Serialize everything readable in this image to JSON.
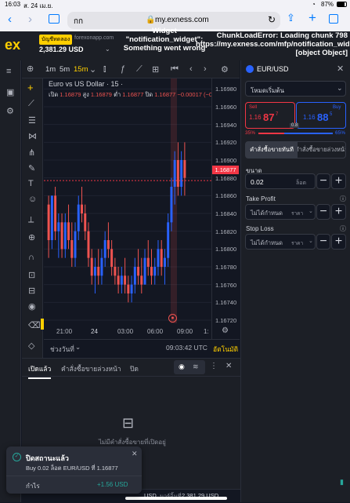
{
  "status": {
    "time": "16:03",
    "date": "ส. 24 เม.ย.",
    "battery": "87%"
  },
  "browser": {
    "aa": "กก",
    "url": "my.exness.com"
  },
  "header": {
    "logo": "ex",
    "account_label": "บัญชีทดลอง",
    "account_site": "forexonapp.com",
    "balance": "2,381.29 USD",
    "error_center": "Widget \"notification_widget\": Something went wrong",
    "error_right_1": "ChunkLoadError: Loading chunk 798",
    "error_right_2": "https://my.exness.com/mfp/notification_widget",
    "error_right_3": "[object Object]"
  },
  "chart_toolbar": {
    "timeframes": [
      "1m",
      "5m",
      "15m"
    ],
    "active": "15m"
  },
  "chart_legend": {
    "title": "Euro vs US Dollar · 15 ·",
    "open_lbl": "เปิด",
    "open": "1.16879",
    "high_lbl": "สูง",
    "high": "1.16879",
    "low_lbl": "ต่ำ",
    "low": "1.16877",
    "close_lbl": "ปิด",
    "close": "1.16877",
    "change": "−0.00017 (−0"
  },
  "chart_data": {
    "type": "candlestick",
    "symbol": "EUR/USD",
    "interval": "15",
    "ylim": [
      1.1672,
      1.1699
    ],
    "y_ticks": [
      "1.16980",
      "1.16960",
      "1.16940",
      "1.16920",
      "1.16900",
      "1.16880",
      "1.16860",
      "1.16840",
      "1.16820",
      "1.16800",
      "1.16780",
      "1.16760",
      "1.16740",
      "1.16720"
    ],
    "x_ticks": [
      "21:00",
      "24",
      "03:00",
      "06:00",
      "09:00",
      "1:"
    ],
    "current_price": "1.16877",
    "candles": [
      [
        1.1685,
        1.1686,
        1.1679,
        1.1681
      ],
      [
        1.1681,
        1.1686,
        1.168,
        1.1686
      ],
      [
        1.1686,
        1.1687,
        1.1681,
        1.1682
      ],
      [
        1.1682,
        1.1684,
        1.1679,
        1.1683
      ],
      [
        1.1683,
        1.1684,
        1.1679,
        1.168
      ],
      [
        1.168,
        1.1684,
        1.1679,
        1.1683
      ],
      [
        1.1683,
        1.1685,
        1.168,
        1.1681
      ],
      [
        1.1681,
        1.1683,
        1.1678,
        1.1679
      ],
      [
        1.1679,
        1.1683,
        1.1678,
        1.1682
      ],
      [
        1.1682,
        1.1686,
        1.1681,
        1.1685
      ],
      [
        1.1685,
        1.1687,
        1.1683,
        1.1684
      ],
      [
        1.1684,
        1.1685,
        1.1681,
        1.1682
      ],
      [
        1.1682,
        1.1683,
        1.1678,
        1.1679
      ],
      [
        1.1679,
        1.168,
        1.1676,
        1.1677
      ],
      [
        1.1677,
        1.1679,
        1.1675,
        1.1678
      ],
      [
        1.1678,
        1.168,
        1.1676,
        1.1677
      ],
      [
        1.1677,
        1.168,
        1.1676,
        1.1679
      ],
      [
        1.1679,
        1.1682,
        1.1678,
        1.1681
      ],
      [
        1.1681,
        1.1683,
        1.1679,
        1.168
      ],
      [
        1.168,
        1.1681,
        1.1677,
        1.1678
      ],
      [
        1.1678,
        1.1679,
        1.1676,
        1.1677
      ],
      [
        1.1677,
        1.1678,
        1.1675,
        1.1676
      ],
      [
        1.1676,
        1.1678,
        1.1675,
        1.1677
      ],
      [
        1.1677,
        1.1679,
        1.1675,
        1.1676
      ],
      [
        1.1676,
        1.1677,
        1.1674,
        1.1675
      ],
      [
        1.1675,
        1.1677,
        1.1674,
        1.1676
      ],
      [
        1.1676,
        1.1679,
        1.1675,
        1.1678
      ],
      [
        1.1678,
        1.168,
        1.1676,
        1.1677
      ],
      [
        1.1677,
        1.1679,
        1.1675,
        1.1676
      ],
      [
        1.1676,
        1.168,
        1.1676,
        1.1679
      ],
      [
        1.1679,
        1.1681,
        1.1677,
        1.1678
      ],
      [
        1.1678,
        1.168,
        1.1676,
        1.1677
      ],
      [
        1.1677,
        1.1679,
        1.1676,
        1.1678
      ],
      [
        1.1678,
        1.1681,
        1.1677,
        1.168
      ],
      [
        1.168,
        1.1681,
        1.1677,
        1.1678
      ],
      [
        1.1678,
        1.168,
        1.1676,
        1.1679
      ],
      [
        1.1679,
        1.1684,
        1.1678,
        1.1683
      ],
      [
        1.1683,
        1.1688,
        1.1682,
        1.1687
      ],
      [
        1.1687,
        1.1691,
        1.1685,
        1.169
      ],
      [
        1.169,
        1.1692,
        1.1686,
        1.1687
      ],
      [
        1.1687,
        1.1691,
        1.1686,
        1.169
      ],
      [
        1.169,
        1.1692,
        1.1686,
        1.1688
      ]
    ]
  },
  "chart_footer": {
    "range_label": "ช่วงวันที่",
    "clock": "09:03:42 UTC",
    "auto": "อัตโนมัติ"
  },
  "order_panel": {
    "pair": "EUR/USD",
    "mode": "โหมดเริ่มต้น",
    "sell_label": "Sell",
    "sell_big": "1.16",
    "sell_mid": "87",
    "sell_small": "7",
    "buy_label": "Buy",
    "buy_big": "1.16",
    "buy_mid": "88",
    "buy_small": "5",
    "spread": "0.8",
    "sell_pct": "35%",
    "sell_pct_value": 35,
    "buy_pct": "65%",
    "tab_market": "คำสั่งซื้อขายทันที",
    "tab_pending": "คำสั่งซื้อขายล่วงหน้า",
    "volume_label": "ขนาด",
    "volume_value": "0.02",
    "volume_unit": "ล็อต",
    "tp_label": "Take Profit",
    "tp_value": "ไม่ได้กำหนด",
    "tp_unit": "ราคา",
    "sl_label": "Stop Loss",
    "sl_value": "ไม่ได้กำหนด",
    "sl_unit": "ราคา"
  },
  "bottom_panel": {
    "tab_open": "เปิดแล้ว",
    "tab_pending": "คำสั่งซื้อขายล่วงหน้า",
    "tab_closed": "ปิด",
    "empty": "ไม่มีคำสั่งซื้อขายที่เปิดอยู่"
  },
  "footer_bar": {
    "currency": "USD",
    "margin_lbl": "มาร์จิ้นที่",
    "margin": "2,381.29 USD"
  },
  "toast": {
    "title": "ปิดสถานะแล้ว",
    "body": "Buy 0.02 ล็อต EUR/USD ที่ 1.16877",
    "profit_lbl": "กำไร",
    "profit": "+1.56 USD"
  },
  "colors": {
    "sell": "#f23645",
    "buy": "#2962ff",
    "up": "#26a69a",
    "down": "#ef5350",
    "accent": "#ffcf00"
  }
}
